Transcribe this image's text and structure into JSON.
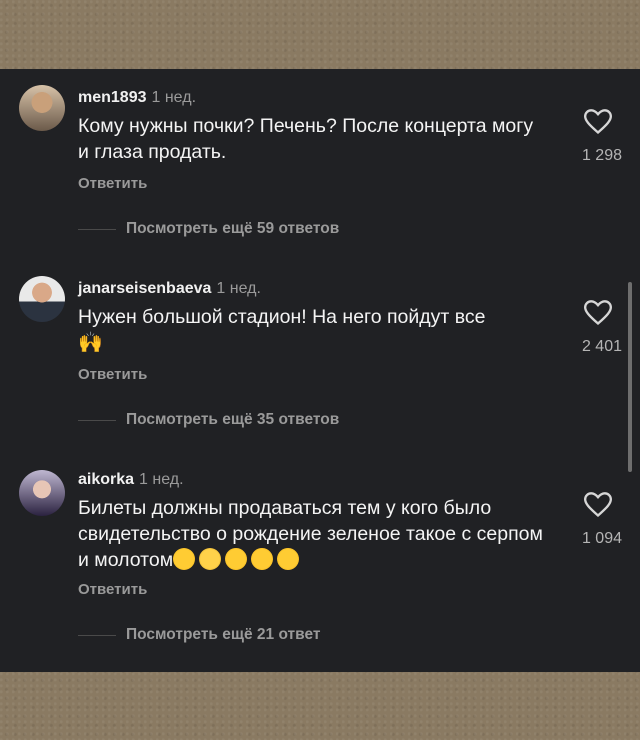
{
  "comments": [
    {
      "username": "men1893",
      "time": "1 нед.",
      "text": "Кому нужны почки? Печень? После концерта могу и глаза продать.",
      "likes": "1 298",
      "reply_label": "Ответить",
      "more_replies": "Посмотреть ещё 59 ответов"
    },
    {
      "username": "janarseisenbaeva",
      "time": "1 нед.",
      "text": "Нужен большой стадион! На него пойдут все",
      "likes": "2 401",
      "reply_label": "Ответить",
      "more_replies": "Посмотреть ещё 35 ответов"
    },
    {
      "username": "aikorka",
      "time": "1 нед.",
      "text": "Билеты должны продаваться тем у кого было свидетельство о рождение зеленое такое с серпом и молотом",
      "likes": "1 094",
      "reply_label": "Ответить",
      "more_replies": "Посмотреть ещё 21 ответ"
    }
  ],
  "icons": {
    "heart": "heart-outline-icon"
  },
  "colors": {
    "panel_bg": "#202124",
    "text": "#f4f4f4",
    "muted": "#9a9a9a"
  }
}
